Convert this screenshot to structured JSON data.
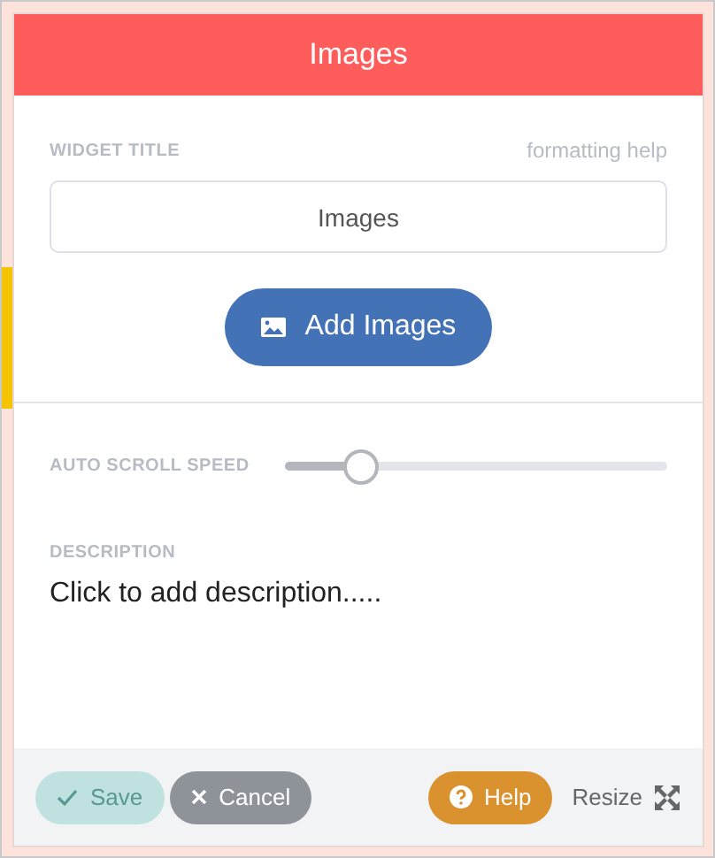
{
  "header": {
    "title": "Images"
  },
  "widget_title": {
    "label": "WIDGET TITLE",
    "help_link": "formatting help",
    "value": "Images"
  },
  "add_button": {
    "label": "Add Images"
  },
  "auto_scroll": {
    "label": "AUTO SCROLL SPEED"
  },
  "description": {
    "label": "DESCRIPTION",
    "text": "Click to add description....."
  },
  "footer": {
    "buttons": [
      {
        "kind": "save",
        "label": "Save",
        "disabled": true
      },
      {
        "kind": "cancel",
        "label": "Cancel",
        "disabled": false
      },
      {
        "kind": "help",
        "label": "Help",
        "disabled": false
      }
    ],
    "resize": {
      "label": "Resize"
    }
  }
}
